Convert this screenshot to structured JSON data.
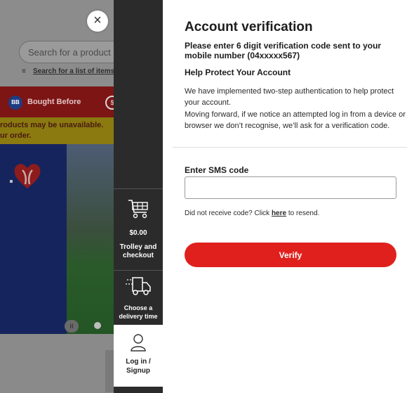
{
  "background_page": {
    "search_placeholder": "Search for a product e.g.",
    "list_link": "Search for a list of items",
    "bought_before_badge": "BB",
    "bought_before_label": "Bought Before",
    "notice_line1": "roducts may be unavailable.",
    "notice_line2": "ur order."
  },
  "close_button": {
    "label": "×"
  },
  "side_rail": {
    "trolley_amount": "$0.00",
    "trolley_label_1": "Trolley and",
    "trolley_label_2": "checkout",
    "delivery_label_1": "Choose a",
    "delivery_label_2": "delivery time",
    "login_label_1": "Log in /",
    "login_label_2": "Signup"
  },
  "modal": {
    "title": "Account verification",
    "subtitle": "Please enter 6 digit verification code sent to your mobile number (04xxxxx567)",
    "help_heading": "Help Protect Your Account",
    "help_paragraph_1": "We have implemented two-step authentication to help protect your account.",
    "help_paragraph_2": "Moving forward, if we notice an attempted log in from a device or browser we don’t recognise, we’ll ask for a verification code.",
    "sms_label": "Enter SMS code",
    "sms_value": "",
    "resend_prefix": "Did not receive code? Click ",
    "resend_link": "here",
    "resend_suffix": " to resend.",
    "verify_label": "Verify"
  },
  "colors": {
    "accent_red": "#e0201c",
    "rail_dark": "#2b2b2b"
  }
}
